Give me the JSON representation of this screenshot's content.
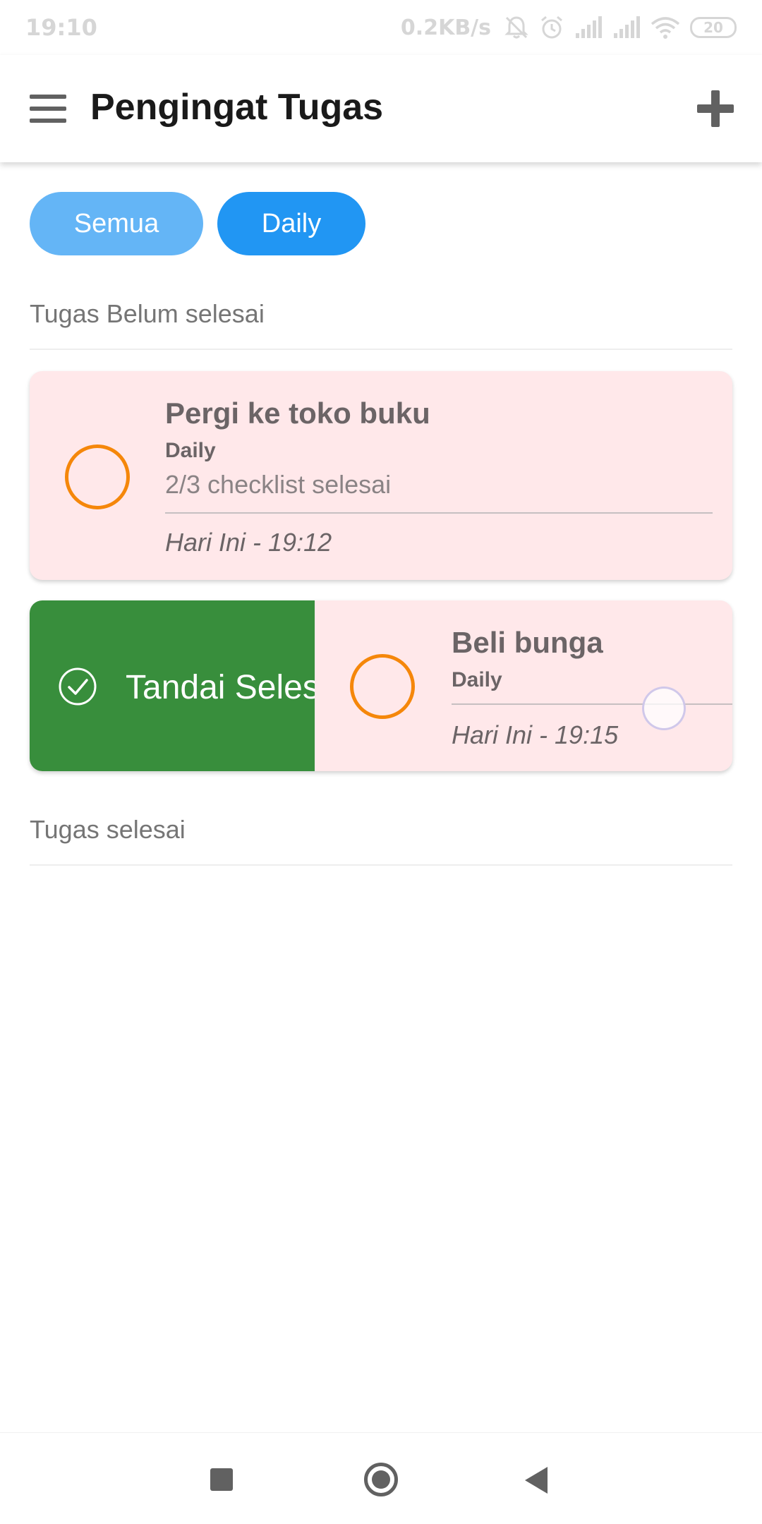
{
  "status_bar": {
    "time": "19:10",
    "network_speed": "0.2KB/s",
    "battery_level": "20",
    "icons": [
      "bell-off-icon",
      "alarm-icon",
      "signal-icon",
      "signal-icon",
      "wifi-icon",
      "battery-icon"
    ]
  },
  "app_bar": {
    "title": "Pengingat Tugas",
    "menu_icon": "hamburger-menu-icon",
    "add_icon": "plus-icon"
  },
  "filters": {
    "all_label": "Semua",
    "daily_label": "Daily",
    "selected": "Daily"
  },
  "sections": {
    "pending_title": "Tugas Belum selesai",
    "done_title": "Tugas selesai"
  },
  "tasks": [
    {
      "title": "Pergi ke toko buku",
      "tag": "Daily",
      "progress": "2/3 checklist selesai",
      "time": "Hari Ini - 19:12"
    },
    {
      "title": "Beli bunga",
      "tag": "Daily",
      "time": "Hari Ini - 19:15",
      "swipe_action_label": "Tandai Selesai"
    }
  ],
  "colors": {
    "accent": "#2196f3",
    "chip_light": "#64b5f6",
    "card_background": "#ffe8ea",
    "task_circle": "#f5870a",
    "swipe_action": "#388e3c"
  },
  "nav_bar": {
    "icons": [
      "recent-apps-icon",
      "home-icon",
      "back-icon"
    ]
  }
}
